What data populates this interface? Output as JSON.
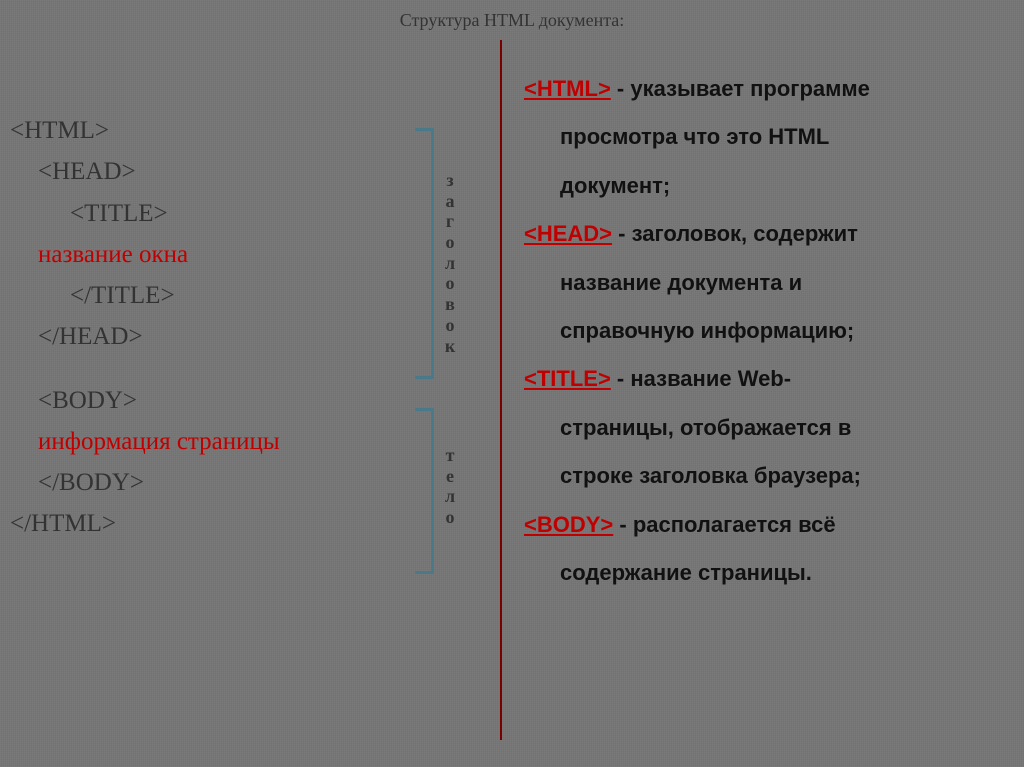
{
  "title": "Структура HTML документа:",
  "code": {
    "l1": "<HTML>",
    "l2": "<HEAD>",
    "l3": "<TITLE>",
    "l4": "название окна",
    "l5": "</TITLE>",
    "l6": "</HEAD>",
    "l7": "<BODY>",
    "l8": "информация страницы",
    "l9": "</BODY>",
    "l10": "</HTML>"
  },
  "labels": {
    "header": "заголовок",
    "body": "тело"
  },
  "desc": {
    "html_tag": "<HTML>",
    "html_line1": " - указывает программе",
    "html_line2": "просмотра что это HTML",
    "html_line3": "документ;",
    "head_tag": "<HEAD>",
    "head_line1": " - заголовок, содержит",
    "head_line2": "название документа и",
    "head_line3": "справочную информацию;",
    "title_tag": "<TITLE>",
    "title_line1": "  - название Web-",
    "title_line2": "страницы, отображается в",
    "title_line3": "строке заголовка браузера;",
    "body_tag": "<BODY>",
    "body_line1": " - располагается всё",
    "body_line2": "содержание страницы."
  }
}
